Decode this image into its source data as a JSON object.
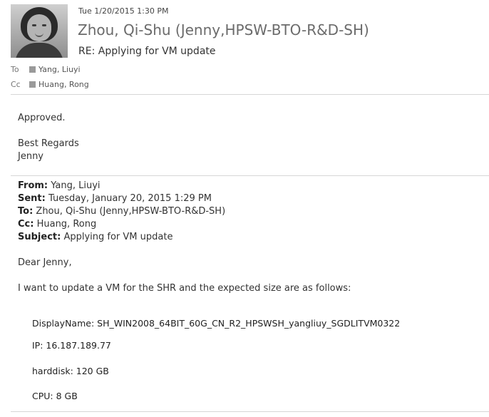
{
  "message": {
    "date": "Tue 1/20/2015 1:30 PM",
    "sender": "Zhou, Qi-Shu (Jenny,HPSW-BTO-R&D-SH)",
    "subject": "RE: Applying for VM update",
    "to_label": "To",
    "to_name": "Yang, Liuyi",
    "cc_label": "Cc",
    "cc_name": "Huang, Rong"
  },
  "reply": {
    "approved": "Approved.",
    "regards": "Best Regards",
    "signature": "Jenny"
  },
  "original": {
    "from_label": "From:",
    "from_value": " Yang, Liuyi",
    "sent_label": "Sent:",
    "sent_value": " Tuesday, January 20, 2015 1:29 PM",
    "to_label": "To:",
    "to_value": " Zhou, Qi-Shu (Jenny,HPSW-BTO-R&D-SH)",
    "cc_label": "Cc:",
    "cc_value": " Huang, Rong",
    "subject_label": "Subject:",
    "subject_value": " Applying for VM update",
    "greeting": "Dear Jenny,",
    "intro": "I want to update a VM for the SHR and the expected size are as follows:",
    "display_name": "DisplayName:  SH_WIN2008_64BIT_60G_CN_R2_HPSWSH_yangliuy_SGDLITVM0322",
    "ip": "IP:  16.187.189.77",
    "harddisk": "harddisk:  120 GB",
    "cpu": "CPU:  8 GB"
  },
  "icons": {
    "avatar": "person-photo",
    "recipient_marker": "contact-square-icon"
  }
}
